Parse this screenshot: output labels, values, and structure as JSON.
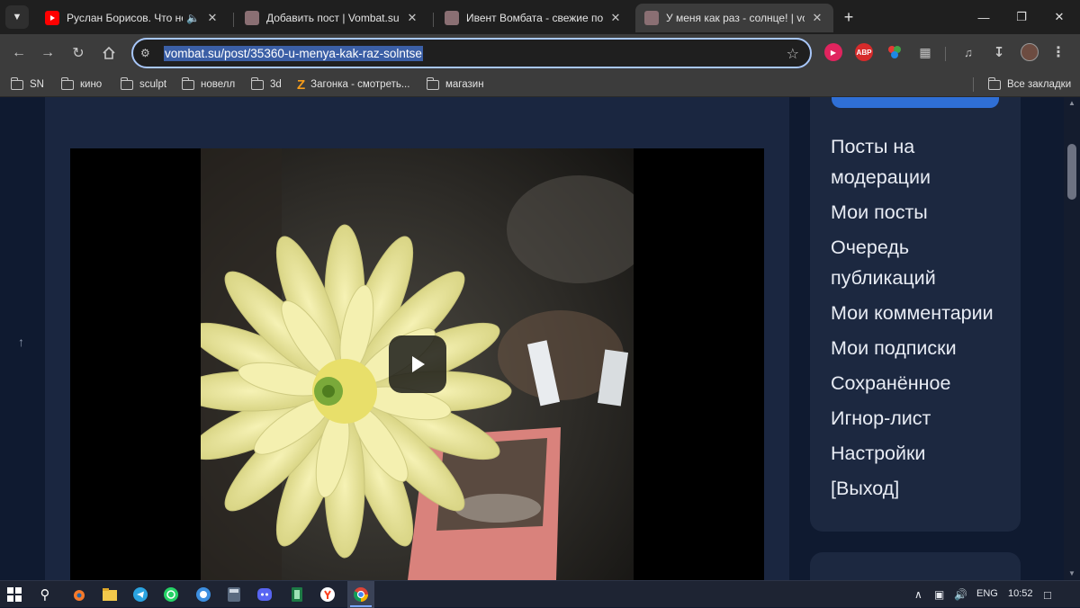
{
  "browser": {
    "tabs": [
      {
        "title": "Руслан Борисов. Что не так",
        "favicon": "youtube-icon",
        "audio": true
      },
      {
        "title": "Добавить пост | Vombat.su",
        "favicon": "vombat-icon"
      },
      {
        "title": "Ивент Вомбата - свежие посты",
        "favicon": "vombat-icon"
      },
      {
        "title": "У меня как раз - солнце! | vombat",
        "favicon": "vombat-icon",
        "active": true
      }
    ],
    "url": "vombat.su/post/35360-u-menya-kak-raz-solntse",
    "bookmarks": [
      "SN",
      "кино",
      "sculpt",
      "новелл",
      "3d",
      "Загонка - смотреть...",
      "магазин"
    ],
    "all_bookmarks": "Все закладки",
    "extensions": {
      "abp": "ABP"
    }
  },
  "sidebar": {
    "menu": [
      "Посты на модерации",
      "Мои посты",
      "Очередь публикаций",
      "Мои комментарии",
      "Мои подписки",
      "Сохранённое",
      "Игнор-лист",
      "Настройки",
      "[Выход]"
    ]
  },
  "taskbar": {
    "language": "ENG",
    "time": "10:52"
  },
  "colors": {
    "page_bg": "#0f1a30",
    "card_bg": "#1a2640",
    "accent": "#2f6fd6"
  }
}
